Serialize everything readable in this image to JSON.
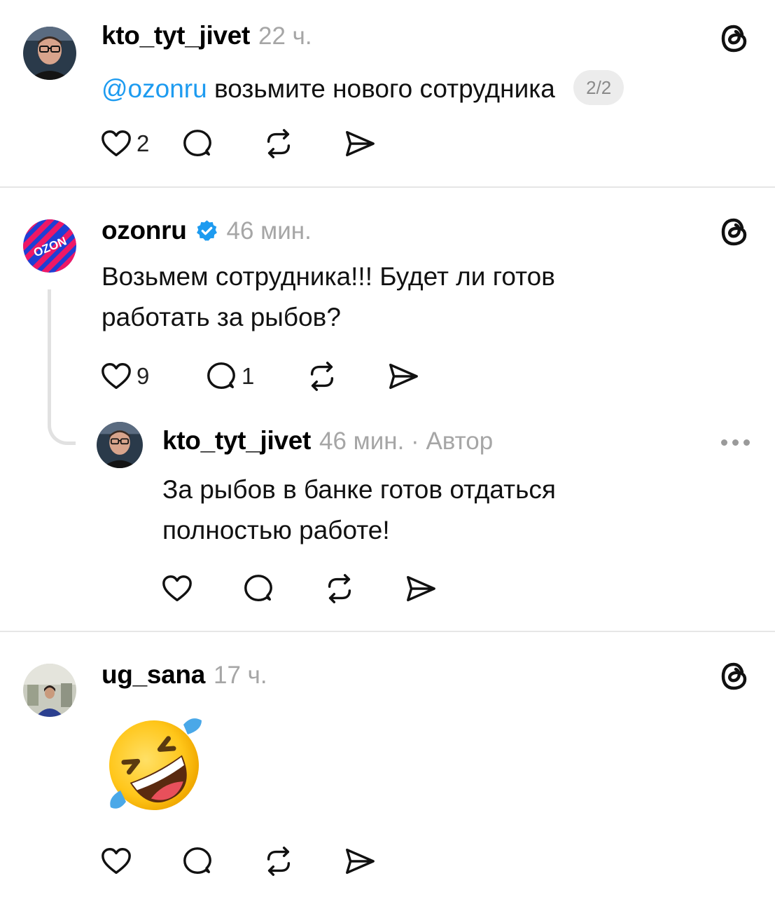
{
  "posts": [
    {
      "username": "kto_tyt_jivet",
      "time": "22 ч.",
      "mention": "@ozonru",
      "text": "возьмите нового сотрудника",
      "pager": "2/2",
      "likes": "2"
    },
    {
      "username": "ozonru",
      "time": "46 мин.",
      "text_line1": "Возьмем сотрудника!!! Будет ли готов",
      "text_line2": "работать за рыбов?",
      "likes": "9",
      "replies": "1",
      "avatar_logo": "OZON"
    },
    {
      "username": "kto_tyt_jivet",
      "time": "46 мин. · Автор",
      "text_line1": "За рыбов в банке готов отдаться",
      "text_line2": "полностью работе!"
    },
    {
      "username": "ug_sana",
      "time": "17 ч.",
      "emoji": "rolling-on-the-floor-laughing"
    }
  ],
  "icons": {
    "like": "heart-icon",
    "reply": "comment-bubble-icon",
    "repost": "repost-icon",
    "share": "send-icon",
    "app": "threads-logo-icon",
    "verified": "verified-badge-icon",
    "more": "more-options-icon"
  },
  "colors": {
    "mention": "#1d9bf0",
    "verified": "#1d9bf0",
    "muted": "#a6a6a6",
    "ozon_blue": "#1e3fd4",
    "ozon_pink": "#ee1866"
  }
}
